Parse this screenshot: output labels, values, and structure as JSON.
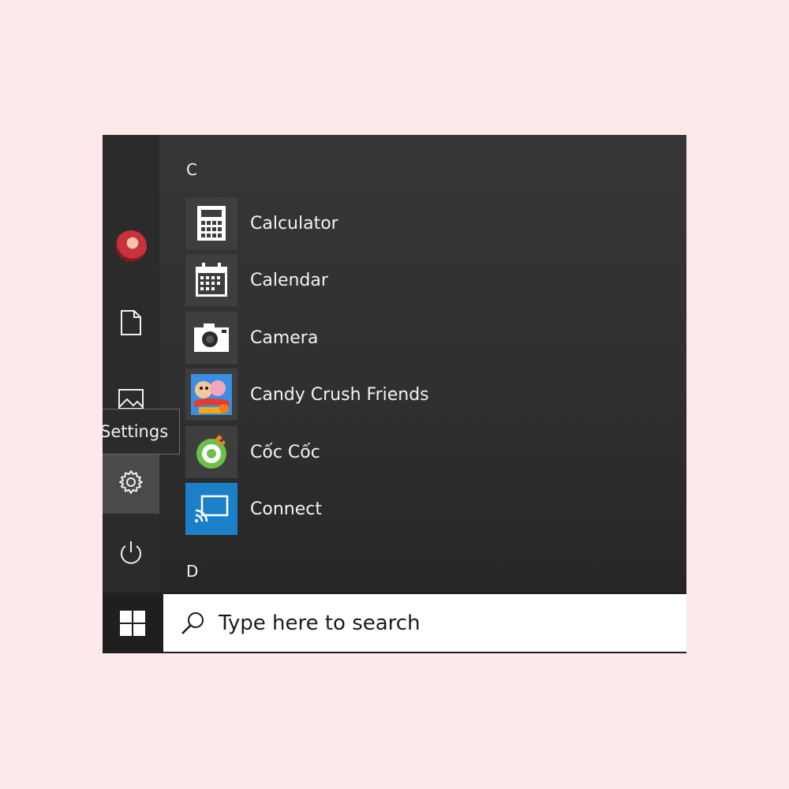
{
  "start_menu": {
    "tooltip": "Settings",
    "sections": [
      {
        "letter": "C",
        "apps": [
          {
            "label": "Calculator",
            "icon": "calculator-icon"
          },
          {
            "label": "Calendar",
            "icon": "calendar-icon"
          },
          {
            "label": "Camera",
            "icon": "camera-icon"
          },
          {
            "label": "Candy Crush Friends",
            "icon": "candy-crush-friends-icon"
          },
          {
            "label": "Cốc Cốc",
            "icon": "coc-coc-icon"
          },
          {
            "label": "Connect",
            "icon": "connect-icon"
          }
        ]
      },
      {
        "letter": "D",
        "apps": []
      }
    ],
    "rail": [
      "user-avatar",
      "documents-icon",
      "pictures-icon",
      "settings-icon",
      "power-icon"
    ]
  },
  "taskbar": {
    "search_placeholder": "Type here to search"
  },
  "colors": {
    "page_background": "#fde9e9",
    "connect_tile": "#1b80c8",
    "rail_active": "#4a4a4a"
  }
}
